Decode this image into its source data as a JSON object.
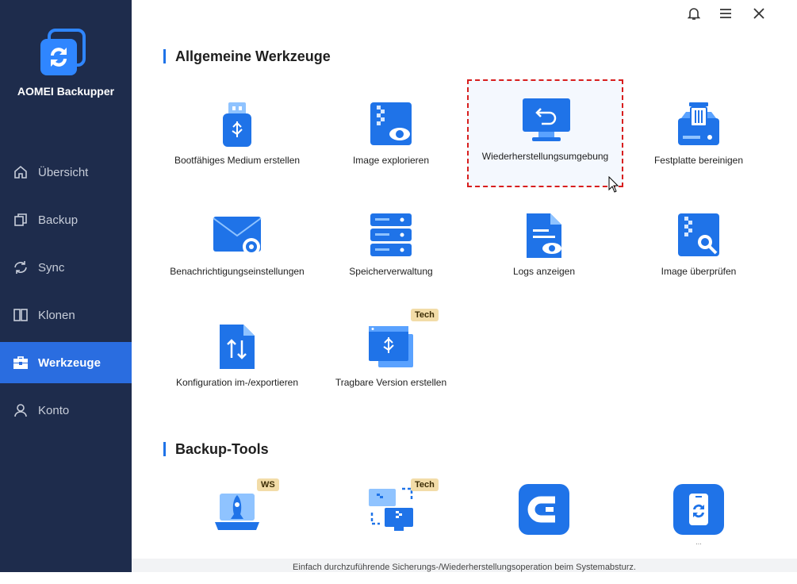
{
  "app": {
    "name": "AOMEI Backupper"
  },
  "sidebar": {
    "items": [
      {
        "label": "Übersicht",
        "icon": "home-icon"
      },
      {
        "label": "Backup",
        "icon": "copy-icon"
      },
      {
        "label": "Sync",
        "icon": "sync-icon"
      },
      {
        "label": "Klonen",
        "icon": "clone-icon"
      },
      {
        "label": "Werkzeuge",
        "icon": "toolbox-icon",
        "active": true
      },
      {
        "label": "Konto",
        "icon": "user-icon"
      }
    ]
  },
  "topbar": {
    "icons": [
      "bell-icon",
      "menu-icon",
      "close-icon"
    ]
  },
  "sections": {
    "general": {
      "title": "Allgemeine Werkzeuge",
      "tools": [
        {
          "label": "Bootfähiges Medium erstellen",
          "icon": "usb-drive-icon"
        },
        {
          "label": "Image explorieren",
          "icon": "image-explore-icon"
        },
        {
          "label": "Wiederherstellungsumgebung",
          "icon": "recovery-monitor-icon",
          "selected": true
        },
        {
          "label": "Festplatte bereinigen",
          "icon": "disk-wipe-icon"
        },
        {
          "label": "Benachrichtigungseinstellungen",
          "icon": "mail-settings-icon"
        },
        {
          "label": "Speicherverwaltung",
          "icon": "storage-server-icon"
        },
        {
          "label": "Logs anzeigen",
          "icon": "log-view-icon"
        },
        {
          "label": "Image überprüfen",
          "icon": "image-check-icon"
        },
        {
          "label": "Konfiguration im-/exportieren",
          "icon": "import-export-icon"
        },
        {
          "label": "Tragbare Version erstellen",
          "icon": "portable-version-icon",
          "badge": "Tech"
        }
      ]
    },
    "backup_tools": {
      "title": "Backup-Tools",
      "tools": [
        {
          "label": "",
          "icon": "rocket-laptop-icon",
          "badge": "WS"
        },
        {
          "label": "",
          "icon": "network-transfer-icon",
          "badge": "Tech"
        },
        {
          "label": "",
          "icon": "centralized-backup-icon"
        },
        {
          "label": "",
          "icon": "phone-sync-icon",
          "caption": "..."
        }
      ]
    }
  },
  "footer": {
    "text": "Einfach durchzuführende Sicherungs-/Wiederherstellungsoperation beim Systemabsturz."
  },
  "colors": {
    "sidebar_bg": "#1e2c4c",
    "active_nav": "#2a6de0",
    "accent": "#1f73e8",
    "selection_border": "#d81e1e",
    "badge_bg": "#f2dca8"
  }
}
